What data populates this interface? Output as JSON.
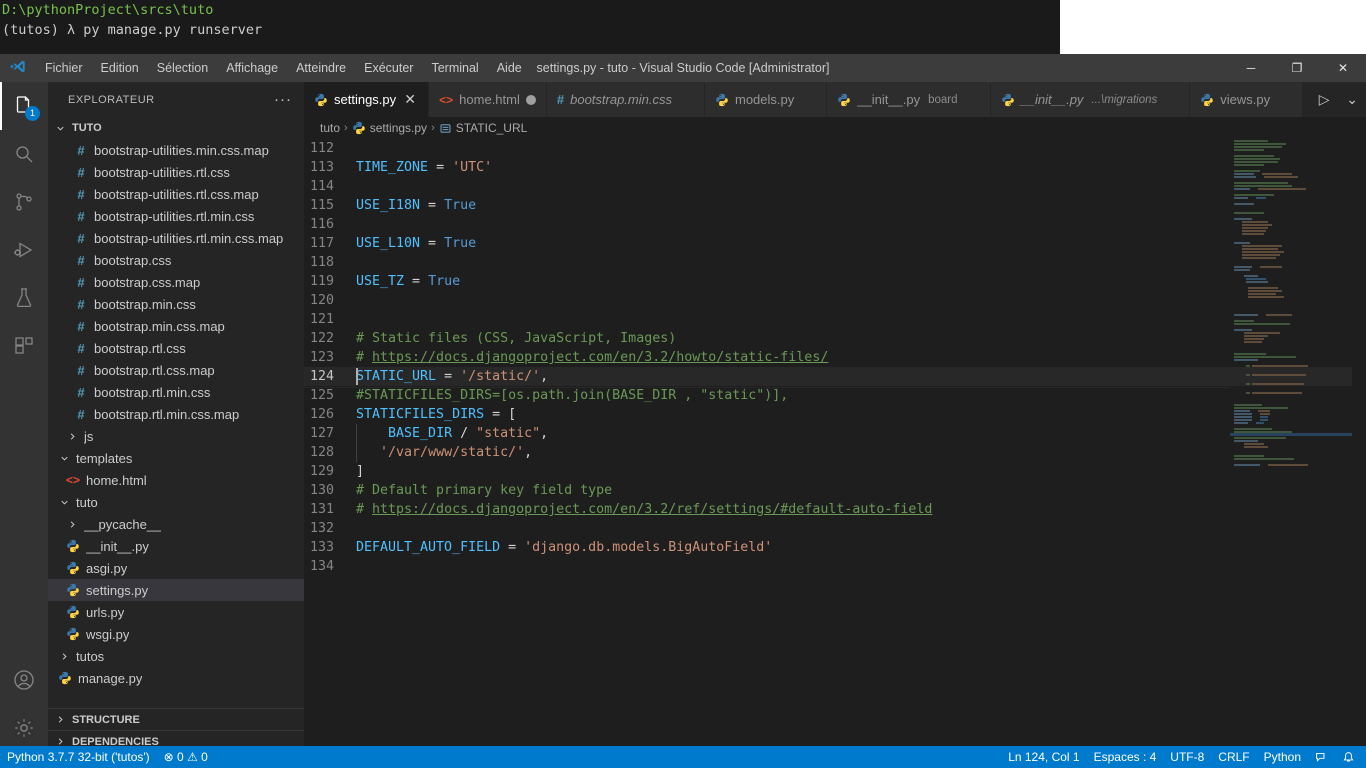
{
  "window": {
    "title": "settings.py - tuto - Visual Studio Code [Administrator]",
    "logo_name": "vscode-logo",
    "minimize": "─",
    "maximize": "❐",
    "close": "✕"
  },
  "menu": {
    "items": [
      {
        "label": "Fichier"
      },
      {
        "label": "Edition"
      },
      {
        "label": "Sélection"
      },
      {
        "label": "Affichage"
      },
      {
        "label": "Atteindre"
      },
      {
        "label": "Exécuter"
      },
      {
        "label": "Terminal"
      },
      {
        "label": "Aide"
      }
    ]
  },
  "terminal_overlay": {
    "path_line": "D:\\pythonProject\\srcs\\tuto",
    "command_line": "(tutos) λ py manage.py runserver"
  },
  "activitybar": {
    "items": [
      {
        "name": "explorer",
        "badge": "1",
        "active": true
      },
      {
        "name": "search",
        "badge": "",
        "active": false
      },
      {
        "name": "source-control",
        "badge": "",
        "active": false
      },
      {
        "name": "run-and-debug",
        "badge": "",
        "active": false
      },
      {
        "name": "testing",
        "badge": "",
        "active": false
      },
      {
        "name": "extensions",
        "badge": "",
        "active": false
      }
    ],
    "bottom": [
      {
        "name": "accounts"
      },
      {
        "name": "manage"
      }
    ]
  },
  "sidebar": {
    "header": "EXPLORATEUR",
    "more_actions": "···",
    "root": {
      "label": "TUTO",
      "expanded": true
    },
    "files": [
      {
        "label": "bootstrap-utilities.min.css.map",
        "icon": "css",
        "indent": 3,
        "type": "file"
      },
      {
        "label": "bootstrap-utilities.rtl.css",
        "icon": "css",
        "indent": 3,
        "type": "file"
      },
      {
        "label": "bootstrap-utilities.rtl.css.map",
        "icon": "css",
        "indent": 3,
        "type": "file"
      },
      {
        "label": "bootstrap-utilities.rtl.min.css",
        "icon": "css",
        "indent": 3,
        "type": "file"
      },
      {
        "label": "bootstrap-utilities.rtl.min.css.map",
        "icon": "css",
        "indent": 3,
        "type": "file"
      },
      {
        "label": "bootstrap.css",
        "icon": "css",
        "indent": 3,
        "type": "file"
      },
      {
        "label": "bootstrap.css.map",
        "icon": "css",
        "indent": 3,
        "type": "file"
      },
      {
        "label": "bootstrap.min.css",
        "icon": "css",
        "indent": 3,
        "type": "file"
      },
      {
        "label": "bootstrap.min.css.map",
        "icon": "css",
        "indent": 3,
        "type": "file"
      },
      {
        "label": "bootstrap.rtl.css",
        "icon": "css",
        "indent": 3,
        "type": "file"
      },
      {
        "label": "bootstrap.rtl.css.map",
        "icon": "css",
        "indent": 3,
        "type": "file"
      },
      {
        "label": "bootstrap.rtl.min.css",
        "icon": "css",
        "indent": 3,
        "type": "file"
      },
      {
        "label": "bootstrap.rtl.min.css.map",
        "icon": "css",
        "indent": 3,
        "type": "file"
      },
      {
        "label": "js",
        "icon": "folder",
        "indent": 2,
        "type": "folder",
        "expanded": false
      },
      {
        "label": "templates",
        "icon": "folder",
        "indent": 1,
        "type": "folder",
        "expanded": true
      },
      {
        "label": "home.html",
        "icon": "html",
        "indent": 2,
        "type": "file"
      },
      {
        "label": "tuto",
        "icon": "folder",
        "indent": 1,
        "type": "folder",
        "expanded": true
      },
      {
        "label": "__pycache__",
        "icon": "folder",
        "indent": 2,
        "type": "folder",
        "expanded": false
      },
      {
        "label": "__init__.py",
        "icon": "py",
        "indent": 2,
        "type": "file"
      },
      {
        "label": "asgi.py",
        "icon": "py",
        "indent": 2,
        "type": "file"
      },
      {
        "label": "settings.py",
        "icon": "py",
        "indent": 2,
        "type": "file",
        "selected": true
      },
      {
        "label": "urls.py",
        "icon": "py",
        "indent": 2,
        "type": "file"
      },
      {
        "label": "wsgi.py",
        "icon": "py",
        "indent": 2,
        "type": "file"
      },
      {
        "label": "tutos",
        "icon": "folder",
        "indent": 1,
        "type": "folder",
        "expanded": false
      },
      {
        "label": "manage.py",
        "icon": "py",
        "indent": 1,
        "type": "file"
      }
    ],
    "sections": [
      {
        "label": "STRUCTURE",
        "expanded": false
      },
      {
        "label": "DEPENDENCIES",
        "expanded": false
      }
    ]
  },
  "tabs": [
    {
      "label": "settings.py",
      "icon": "python",
      "active": true,
      "dirty": false,
      "preview": false,
      "suffix": ""
    },
    {
      "label": "home.html",
      "icon": "html",
      "active": false,
      "dirty": true,
      "preview": false,
      "suffix": ""
    },
    {
      "label": "bootstrap.min.css",
      "icon": "css",
      "active": false,
      "dirty": false,
      "preview": true,
      "suffix": ""
    },
    {
      "label": "models.py",
      "icon": "python",
      "active": false,
      "dirty": false,
      "preview": false,
      "suffix": ""
    },
    {
      "label": "__init__.py",
      "icon": "python",
      "active": false,
      "dirty": false,
      "preview": false,
      "suffix": "board"
    },
    {
      "label": "__init__.py",
      "icon": "python",
      "active": false,
      "dirty": false,
      "preview": true,
      "suffix": "...\\migrations"
    },
    {
      "label": "views.py",
      "icon": "python",
      "active": false,
      "dirty": false,
      "preview": false,
      "suffix": ""
    }
  ],
  "tab_actions": [
    {
      "name": "run-python-file",
      "glyph": "▷"
    },
    {
      "name": "run-chevron-down",
      "glyph": "⌄"
    },
    {
      "name": "split-editor-right",
      "glyph": "◫"
    },
    {
      "name": "more-actions",
      "glyph": "···"
    }
  ],
  "breadcrumbs": [
    {
      "label": "tuto",
      "icon": ""
    },
    {
      "label": "settings.py",
      "icon": "python"
    },
    {
      "label": "STATIC_URL",
      "icon": "field"
    }
  ],
  "code": {
    "first_line": 112,
    "current_line": 124,
    "lines": [
      {
        "n": 112,
        "tokens": []
      },
      {
        "n": 113,
        "tokens": [
          {
            "t": "TIME_ZONE",
            "c": "k-const"
          },
          {
            "t": " = ",
            "c": "k-op"
          },
          {
            "t": "'UTC'",
            "c": "k-str"
          }
        ]
      },
      {
        "n": 114,
        "tokens": []
      },
      {
        "n": 115,
        "tokens": [
          {
            "t": "USE_I18N",
            "c": "k-const"
          },
          {
            "t": " = ",
            "c": "k-op"
          },
          {
            "t": "True",
            "c": "k-bool"
          }
        ]
      },
      {
        "n": 116,
        "tokens": []
      },
      {
        "n": 117,
        "tokens": [
          {
            "t": "USE_L10N",
            "c": "k-const"
          },
          {
            "t": " = ",
            "c": "k-op"
          },
          {
            "t": "True",
            "c": "k-bool"
          }
        ]
      },
      {
        "n": 118,
        "tokens": []
      },
      {
        "n": 119,
        "tokens": [
          {
            "t": "USE_TZ",
            "c": "k-const"
          },
          {
            "t": " = ",
            "c": "k-op"
          },
          {
            "t": "True",
            "c": "k-bool"
          }
        ]
      },
      {
        "n": 120,
        "tokens": []
      },
      {
        "n": 121,
        "tokens": []
      },
      {
        "n": 122,
        "tokens": [
          {
            "t": "# Static files (CSS, JavaScript, Images)",
            "c": "k-com"
          }
        ]
      },
      {
        "n": 123,
        "tokens": [
          {
            "t": "# ",
            "c": "k-com"
          },
          {
            "t": "https://docs.djangoproject.com/en/3.2/howto/static-files/",
            "c": "k-link"
          }
        ]
      },
      {
        "n": 124,
        "tokens": [
          {
            "t": "STATIC_URL",
            "c": "k-const"
          },
          {
            "t": " = ",
            "c": "k-op"
          },
          {
            "t": "'/static/'",
            "c": "k-str"
          },
          {
            "t": ",",
            "c": "k-punct"
          }
        ]
      },
      {
        "n": 125,
        "tokens": [
          {
            "t": "#STATICFILES_DIRS=[os.path.join(BASE_DIR , \"static\")],",
            "c": "k-com"
          }
        ]
      },
      {
        "n": 126,
        "tokens": [
          {
            "t": "STATICFILES_DIRS",
            "c": "k-const"
          },
          {
            "t": " = ",
            "c": "k-op"
          },
          {
            "t": "[",
            "c": "k-punct"
          }
        ]
      },
      {
        "n": 127,
        "tokens": [
          {
            "t": "    ",
            "c": "k-op"
          },
          {
            "t": "BASE_DIR",
            "c": "k-const"
          },
          {
            "t": " / ",
            "c": "k-op"
          },
          {
            "t": "\"static\"",
            "c": "k-str"
          },
          {
            "t": ",",
            "c": "k-punct"
          }
        ]
      },
      {
        "n": 128,
        "tokens": [
          {
            "t": "   ",
            "c": "k-op"
          },
          {
            "t": "'/var/www/static/'",
            "c": "k-str"
          },
          {
            "t": ",",
            "c": "k-punct"
          }
        ]
      },
      {
        "n": 129,
        "tokens": [
          {
            "t": "]",
            "c": "k-punct"
          }
        ]
      },
      {
        "n": 130,
        "tokens": [
          {
            "t": "# Default primary key field type",
            "c": "k-com"
          }
        ]
      },
      {
        "n": 131,
        "tokens": [
          {
            "t": "# ",
            "c": "k-com"
          },
          {
            "t": "https://docs.djangoproject.com/en/3.2/ref/settings/#default-auto-field",
            "c": "k-link"
          }
        ]
      },
      {
        "n": 132,
        "tokens": []
      },
      {
        "n": 133,
        "tokens": [
          {
            "t": "DEFAULT_AUTO_FIELD",
            "c": "k-const"
          },
          {
            "t": " = ",
            "c": "k-op"
          },
          {
            "t": "'django.db.models.BigAutoField'",
            "c": "k-str"
          }
        ]
      },
      {
        "n": 134,
        "tokens": []
      }
    ]
  },
  "statusbar": {
    "left": [
      {
        "name": "python-interpreter",
        "label": "Python 3.7.7 32-bit ('tutos')"
      },
      {
        "name": "problems",
        "label": "⊗ 0  ⚠ 0"
      }
    ],
    "right": [
      {
        "name": "line-col",
        "label": "Ln 124, Col 1"
      },
      {
        "name": "indentation",
        "label": "Espaces : 4"
      },
      {
        "name": "encoding",
        "label": "UTF-8"
      },
      {
        "name": "eol",
        "label": "CRLF"
      },
      {
        "name": "language-mode",
        "label": "Python"
      },
      {
        "name": "notifications",
        "label": "ὑ4"
      }
    ]
  },
  "colors": {
    "accent": "#007acc",
    "titlebar_bg": "#3c3c3c",
    "sidebar_bg": "#252526",
    "editor_bg": "#1e1e1e",
    "activitybar_bg": "#333333",
    "selection_bg": "#37373d",
    "string": "#ce9178",
    "comment": "#6a9955",
    "constant": "#4fc1ff",
    "keyword": "#569cd6"
  }
}
